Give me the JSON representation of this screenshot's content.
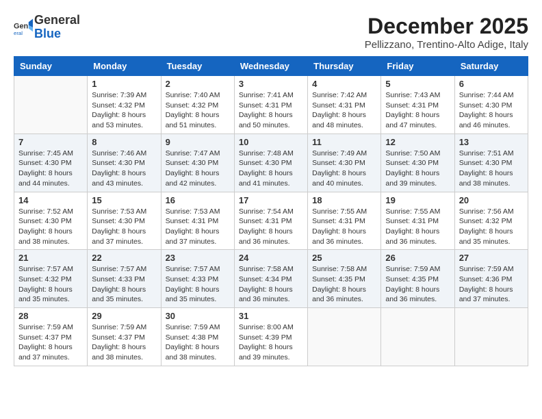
{
  "header": {
    "logo_general": "General",
    "logo_blue": "Blue",
    "month_title": "December 2025",
    "location": "Pellizzano, Trentino-Alto Adige, Italy"
  },
  "weekdays": [
    "Sunday",
    "Monday",
    "Tuesday",
    "Wednesday",
    "Thursday",
    "Friday",
    "Saturday"
  ],
  "weeks": [
    [
      {
        "day": "",
        "info": ""
      },
      {
        "day": "1",
        "info": "Sunrise: 7:39 AM\nSunset: 4:32 PM\nDaylight: 8 hours\nand 53 minutes."
      },
      {
        "day": "2",
        "info": "Sunrise: 7:40 AM\nSunset: 4:32 PM\nDaylight: 8 hours\nand 51 minutes."
      },
      {
        "day": "3",
        "info": "Sunrise: 7:41 AM\nSunset: 4:31 PM\nDaylight: 8 hours\nand 50 minutes."
      },
      {
        "day": "4",
        "info": "Sunrise: 7:42 AM\nSunset: 4:31 PM\nDaylight: 8 hours\nand 48 minutes."
      },
      {
        "day": "5",
        "info": "Sunrise: 7:43 AM\nSunset: 4:31 PM\nDaylight: 8 hours\nand 47 minutes."
      },
      {
        "day": "6",
        "info": "Sunrise: 7:44 AM\nSunset: 4:30 PM\nDaylight: 8 hours\nand 46 minutes."
      }
    ],
    [
      {
        "day": "7",
        "info": "Sunrise: 7:45 AM\nSunset: 4:30 PM\nDaylight: 8 hours\nand 44 minutes."
      },
      {
        "day": "8",
        "info": "Sunrise: 7:46 AM\nSunset: 4:30 PM\nDaylight: 8 hours\nand 43 minutes."
      },
      {
        "day": "9",
        "info": "Sunrise: 7:47 AM\nSunset: 4:30 PM\nDaylight: 8 hours\nand 42 minutes."
      },
      {
        "day": "10",
        "info": "Sunrise: 7:48 AM\nSunset: 4:30 PM\nDaylight: 8 hours\nand 41 minutes."
      },
      {
        "day": "11",
        "info": "Sunrise: 7:49 AM\nSunset: 4:30 PM\nDaylight: 8 hours\nand 40 minutes."
      },
      {
        "day": "12",
        "info": "Sunrise: 7:50 AM\nSunset: 4:30 PM\nDaylight: 8 hours\nand 39 minutes."
      },
      {
        "day": "13",
        "info": "Sunrise: 7:51 AM\nSunset: 4:30 PM\nDaylight: 8 hours\nand 38 minutes."
      }
    ],
    [
      {
        "day": "14",
        "info": "Sunrise: 7:52 AM\nSunset: 4:30 PM\nDaylight: 8 hours\nand 38 minutes."
      },
      {
        "day": "15",
        "info": "Sunrise: 7:53 AM\nSunset: 4:30 PM\nDaylight: 8 hours\nand 37 minutes."
      },
      {
        "day": "16",
        "info": "Sunrise: 7:53 AM\nSunset: 4:31 PM\nDaylight: 8 hours\nand 37 minutes."
      },
      {
        "day": "17",
        "info": "Sunrise: 7:54 AM\nSunset: 4:31 PM\nDaylight: 8 hours\nand 36 minutes."
      },
      {
        "day": "18",
        "info": "Sunrise: 7:55 AM\nSunset: 4:31 PM\nDaylight: 8 hours\nand 36 minutes."
      },
      {
        "day": "19",
        "info": "Sunrise: 7:55 AM\nSunset: 4:31 PM\nDaylight: 8 hours\nand 36 minutes."
      },
      {
        "day": "20",
        "info": "Sunrise: 7:56 AM\nSunset: 4:32 PM\nDaylight: 8 hours\nand 35 minutes."
      }
    ],
    [
      {
        "day": "21",
        "info": "Sunrise: 7:57 AM\nSunset: 4:32 PM\nDaylight: 8 hours\nand 35 minutes."
      },
      {
        "day": "22",
        "info": "Sunrise: 7:57 AM\nSunset: 4:33 PM\nDaylight: 8 hours\nand 35 minutes."
      },
      {
        "day": "23",
        "info": "Sunrise: 7:57 AM\nSunset: 4:33 PM\nDaylight: 8 hours\nand 35 minutes."
      },
      {
        "day": "24",
        "info": "Sunrise: 7:58 AM\nSunset: 4:34 PM\nDaylight: 8 hours\nand 36 minutes."
      },
      {
        "day": "25",
        "info": "Sunrise: 7:58 AM\nSunset: 4:35 PM\nDaylight: 8 hours\nand 36 minutes."
      },
      {
        "day": "26",
        "info": "Sunrise: 7:59 AM\nSunset: 4:35 PM\nDaylight: 8 hours\nand 36 minutes."
      },
      {
        "day": "27",
        "info": "Sunrise: 7:59 AM\nSunset: 4:36 PM\nDaylight: 8 hours\nand 37 minutes."
      }
    ],
    [
      {
        "day": "28",
        "info": "Sunrise: 7:59 AM\nSunset: 4:37 PM\nDaylight: 8 hours\nand 37 minutes."
      },
      {
        "day": "29",
        "info": "Sunrise: 7:59 AM\nSunset: 4:37 PM\nDaylight: 8 hours\nand 38 minutes."
      },
      {
        "day": "30",
        "info": "Sunrise: 7:59 AM\nSunset: 4:38 PM\nDaylight: 8 hours\nand 38 minutes."
      },
      {
        "day": "31",
        "info": "Sunrise: 8:00 AM\nSunset: 4:39 PM\nDaylight: 8 hours\nand 39 minutes."
      },
      {
        "day": "",
        "info": ""
      },
      {
        "day": "",
        "info": ""
      },
      {
        "day": "",
        "info": ""
      }
    ]
  ]
}
